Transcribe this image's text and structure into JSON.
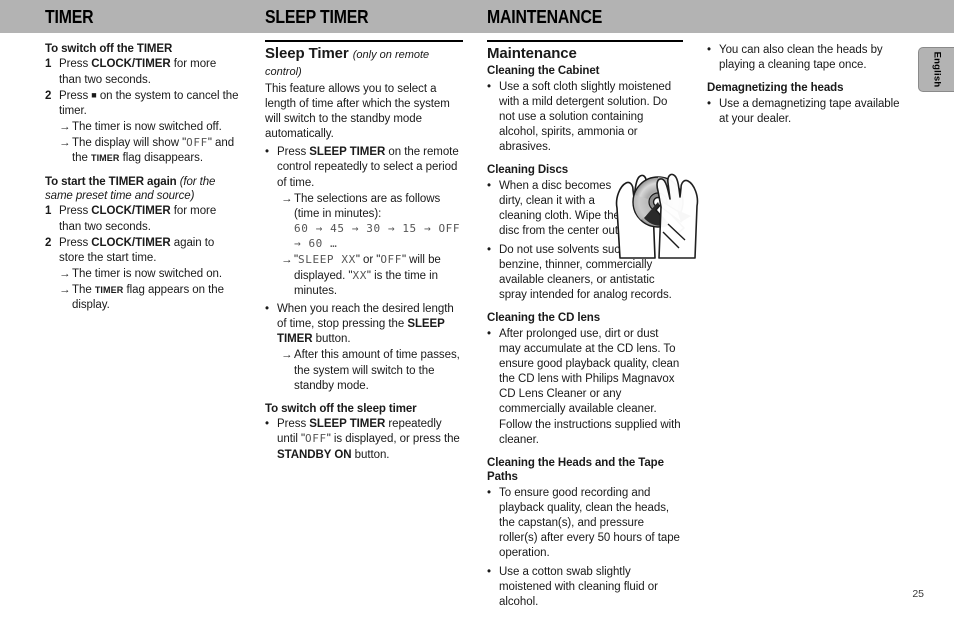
{
  "header": {
    "titles": [
      {
        "label": "TIMER"
      },
      {
        "label": "SLEEP TIMER"
      },
      {
        "label": "MAINTENANCE"
      }
    ],
    "band_color": "#b3b3b3"
  },
  "side_tab": {
    "label": "English"
  },
  "page_number": "25",
  "column1": {
    "section1": {
      "heading_pre": "To switch off the ",
      "heading_bold": "TIMER",
      "steps": [
        {
          "num": "1",
          "pre": "Press ",
          "bold": "CLOCK/TIMER",
          "post": " for more than two seconds."
        },
        {
          "num": "2",
          "pre": "Press ",
          "icon": "stop-square-icon",
          "post": " on the system to cancel the timer."
        }
      ],
      "arrows": [
        {
          "text": "The timer is now switched off."
        },
        {
          "pre": "The display will show \"",
          "lcd": "OFF",
          "mid": "\" and the ",
          "smallcaps": "TIMER",
          "post": " flag disappears."
        }
      ]
    },
    "section2": {
      "heading_pre": "To start the ",
      "heading_bold": "TIMER",
      "heading_post": " again ",
      "heading_note": "(for the same preset time and source)",
      "steps": [
        {
          "num": "1",
          "pre": "Press ",
          "bold": "CLOCK/TIMER",
          "post": " for more than two seconds."
        },
        {
          "num": "2",
          "pre": "Press ",
          "bold": "CLOCK/TIMER",
          "post": " again to store the start time."
        }
      ],
      "arrows": [
        {
          "text": "The timer is now switched on."
        },
        {
          "pre": "The ",
          "smallcaps": "TIMER",
          "post": " flag appears on the display."
        }
      ]
    }
  },
  "column2": {
    "title": "Sleep Timer",
    "title_note": "(only on remote control)",
    "intro": "This feature allows you to select a length of time after which the system will switch to the standby mode automatically.",
    "bullet1": {
      "pre": "Press ",
      "bold": "SLEEP TIMER",
      "post": " on the remote control repeatedly to select a period of time."
    },
    "bullet1_arrows": [
      {
        "text": "The selections are as follows (time in minutes):",
        "lcd_sequence": "60 → 45 → 30 →  15 → OFF → 60 …"
      },
      {
        "pre": "\"",
        "lcd1": "SLEEP XX",
        "mid1": "\" or \"",
        "lcd2": "OFF",
        "mid2": "\" will be displayed. \"",
        "lcd3": "XX",
        "post": "\" is the time in minutes."
      }
    ],
    "bullet2": {
      "pre": "When you reach the desired length of time, stop pressing the ",
      "bold": "SLEEP TIMER",
      "post": " button."
    },
    "bullet2_arrow": "After this amount of time passes, the system will switch to the standby mode.",
    "switch_off_heading": "To switch off the sleep timer",
    "switch_off_bullet": {
      "pre": "Press ",
      "bold1": "SLEEP TIMER",
      "mid1": " repeatedly until \"",
      "lcd": "OFF",
      "mid2": "\" is displayed, or press the ",
      "bold2": "STANDBY ON",
      "post": " button."
    }
  },
  "column3": {
    "title": "Maintenance",
    "cabinet": {
      "heading": "Cleaning the Cabinet",
      "bullets": [
        "Use a soft cloth slightly moistened with a mild detergent solution. Do not use a solution containing alcohol, spirits, ammonia or abrasives."
      ]
    },
    "discs": {
      "heading": "Cleaning Discs",
      "bullets": [
        "When a disc becomes dirty, clean it with a cleaning cloth. Wipe the disc from the center out.",
        "Do not use solvents such as benzine, thinner, commercially available cleaners, or antistatic spray intended for analog records."
      ],
      "figure_name": "cd-cleaning-illustration"
    },
    "cd_lens": {
      "heading": "Cleaning the CD lens",
      "bullets": [
        "After prolonged use, dirt or dust may accumulate at the CD lens. To ensure good playback quality, clean the CD lens with Philips Magnavox CD Lens Cleaner or any commercially available cleaner. Follow the instructions supplied with cleaner."
      ]
    },
    "heads_tape": {
      "heading": "Cleaning the Heads and the Tape Paths",
      "bullets": [
        "To ensure good recording and playback quality, clean the heads, the capstan(s), and pressure roller(s) after every 50 hours of tape operation.",
        "Use a cotton swab slightly moistened with cleaning fluid or alcohol."
      ]
    }
  },
  "column4": {
    "bullets_top": [
      "You can also clean the heads by playing a cleaning tape once."
    ],
    "demagnetizing": {
      "heading": "Demagnetizing the heads",
      "bullets": [
        "Use a demagnetizing tape available at your dealer."
      ]
    }
  }
}
